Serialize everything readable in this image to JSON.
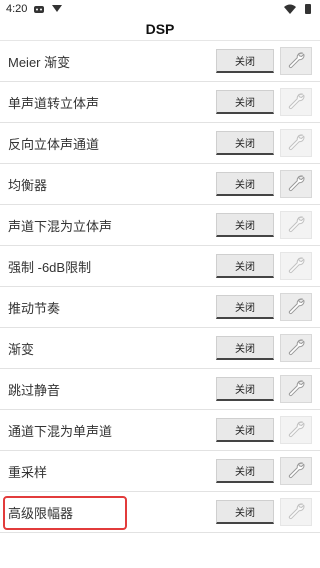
{
  "statusbar": {
    "time": "4:20"
  },
  "header": {
    "title": "DSP"
  },
  "toggle_label": "关闭",
  "rows": [
    {
      "label": "Meier 渐变",
      "settings_enabled": true
    },
    {
      "label": "单声道转立体声",
      "settings_enabled": false
    },
    {
      "label": "反向立体声通道",
      "settings_enabled": false
    },
    {
      "label": "均衡器",
      "settings_enabled": true
    },
    {
      "label": "声道下混为立体声",
      "settings_enabled": false
    },
    {
      "label": "强制 -6dB限制",
      "settings_enabled": false
    },
    {
      "label": "推动节奏",
      "settings_enabled": true
    },
    {
      "label": "渐变",
      "settings_enabled": true
    },
    {
      "label": "跳过静音",
      "settings_enabled": true
    },
    {
      "label": "通道下混为单声道",
      "settings_enabled": false
    },
    {
      "label": "重采样",
      "settings_enabled": true
    },
    {
      "label": "高级限幅器",
      "settings_enabled": false
    }
  ],
  "highlight_color": "#e23b3b"
}
